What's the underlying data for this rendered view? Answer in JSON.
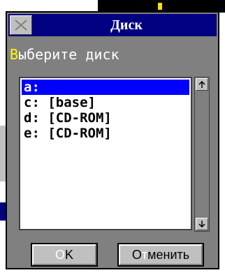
{
  "dialog": {
    "title": "Диск",
    "prompt_hotkey": "В",
    "prompt_rest": "ыберите диск"
  },
  "drives": [
    {
      "label": "a:",
      "selected": true
    },
    {
      "label": "c: [base]",
      "selected": false
    },
    {
      "label": "d: [CD-ROM]",
      "selected": false
    },
    {
      "label": "e: [CD-ROM]",
      "selected": false
    }
  ],
  "buttons": {
    "ok_pre": "",
    "ok_hotkey": "O",
    "ok_rest": "K",
    "cancel_pre": "О",
    "cancel_hotkey": "т",
    "cancel_rest": "менить"
  },
  "icons": {
    "close": "close-icon",
    "scroll_up": "scroll-up-arrow-icon",
    "scroll_down": "scroll-down-arrow-icon"
  },
  "colors": {
    "titlebar": "#000080",
    "selection": "#0000ff",
    "hotkey": "#ffff00",
    "dialog_bg": "#808080"
  }
}
